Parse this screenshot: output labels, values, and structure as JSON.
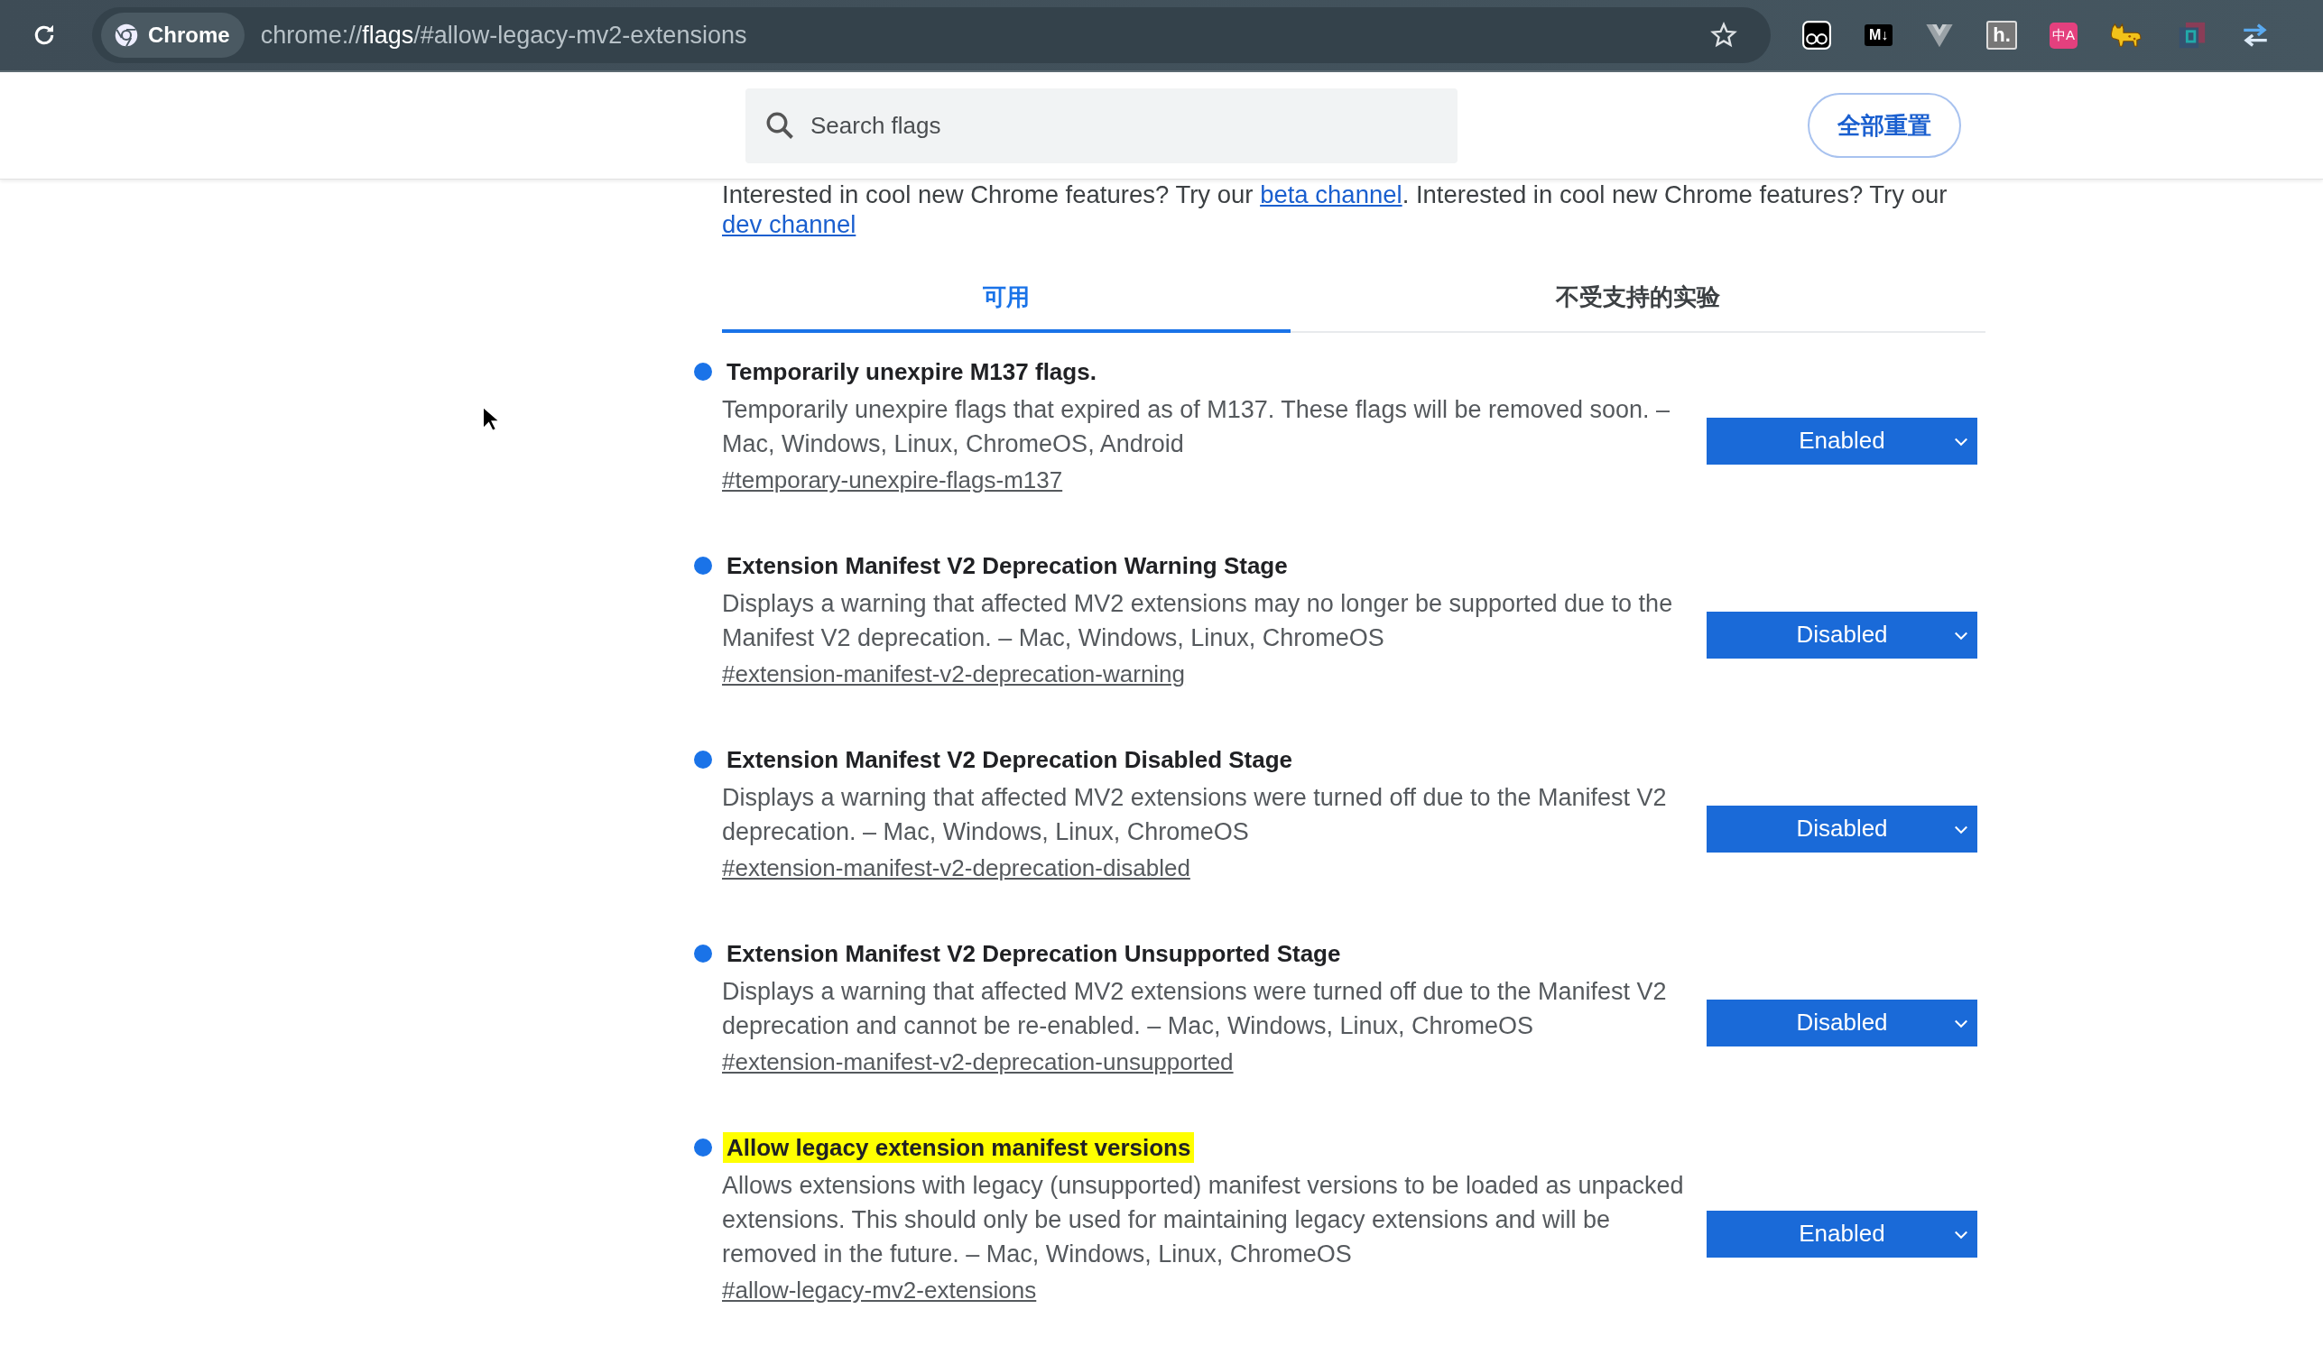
{
  "toolbar": {
    "chip_label": "Chrome",
    "url": "chrome://**flags**/#allow-legacy-mv2-extensions",
    "extensions": [
      {
        "kind": "glasses"
      },
      {
        "kind": "markdown",
        "text": "M↓"
      },
      {
        "kind": "vee"
      },
      {
        "kind": "bubble",
        "text": "h."
      },
      {
        "kind": "translate",
        "text": "中A"
      },
      {
        "kind": "cat"
      },
      {
        "kind": "square"
      },
      {
        "kind": "arrows"
      }
    ]
  },
  "header": {
    "search": {
      "placeholder": "Search flags"
    },
    "reset_button": "全部重置"
  },
  "intro": [
    {
      "kind": "text",
      "text": "Interested in cool new Chrome features? Try our "
    },
    {
      "kind": "link",
      "text": "beta channel"
    },
    {
      "kind": "text",
      "text": ". Interested in cool new Chrome features? Try our "
    },
    {
      "kind": "link",
      "text": "dev channel"
    }
  ],
  "tabs": [
    {
      "label": "可用",
      "selected": true
    },
    {
      "label": "不受支持的实验",
      "selected": false
    }
  ],
  "flags": [
    {
      "title": "Temporarily unexpire M137 flags.",
      "modified": true,
      "highlighted": false,
      "description": "Temporarily unexpire flags that expired as of M137. These flags will be removed soon. – Mac, Windows, Linux, ChromeOS, Android",
      "anchor": "#temporary-unexpire-flags-m137",
      "value": "Enabled"
    },
    {
      "title": "Extension Manifest V2 Deprecation Warning Stage",
      "modified": true,
      "highlighted": false,
      "description": "Displays a warning that affected MV2 extensions may no longer be supported due to the Manifest V2 deprecation. – Mac, Windows, Linux, ChromeOS",
      "anchor": "#extension-manifest-v2-deprecation-warning",
      "value": "Disabled"
    },
    {
      "title": "Extension Manifest V2 Deprecation Disabled Stage",
      "modified": true,
      "highlighted": false,
      "description": "Displays a warning that affected MV2 extensions were turned off due to the Manifest V2 deprecation. – Mac, Windows, Linux, ChromeOS",
      "anchor": "#extension-manifest-v2-deprecation-disabled",
      "value": "Disabled"
    },
    {
      "title": "Extension Manifest V2 Deprecation Unsupported Stage",
      "modified": true,
      "highlighted": false,
      "description": "Displays a warning that affected MV2 extensions were turned off due to the Manifest V2 deprecation and cannot be re-enabled. – Mac, Windows, Linux, ChromeOS",
      "anchor": "#extension-manifest-v2-deprecation-unsupported",
      "value": "Disabled"
    },
    {
      "title": "Allow legacy extension manifest versions",
      "modified": true,
      "highlighted": true,
      "description": "Allows extensions with legacy (unsupported) manifest versions to be loaded as unpacked extensions. This should only be used for maintaining legacy extensions and will be removed in the future. – Mac, Windows, Linux, ChromeOS",
      "anchor": "#allow-legacy-mv2-extensions",
      "value": "Enabled"
    }
  ]
}
